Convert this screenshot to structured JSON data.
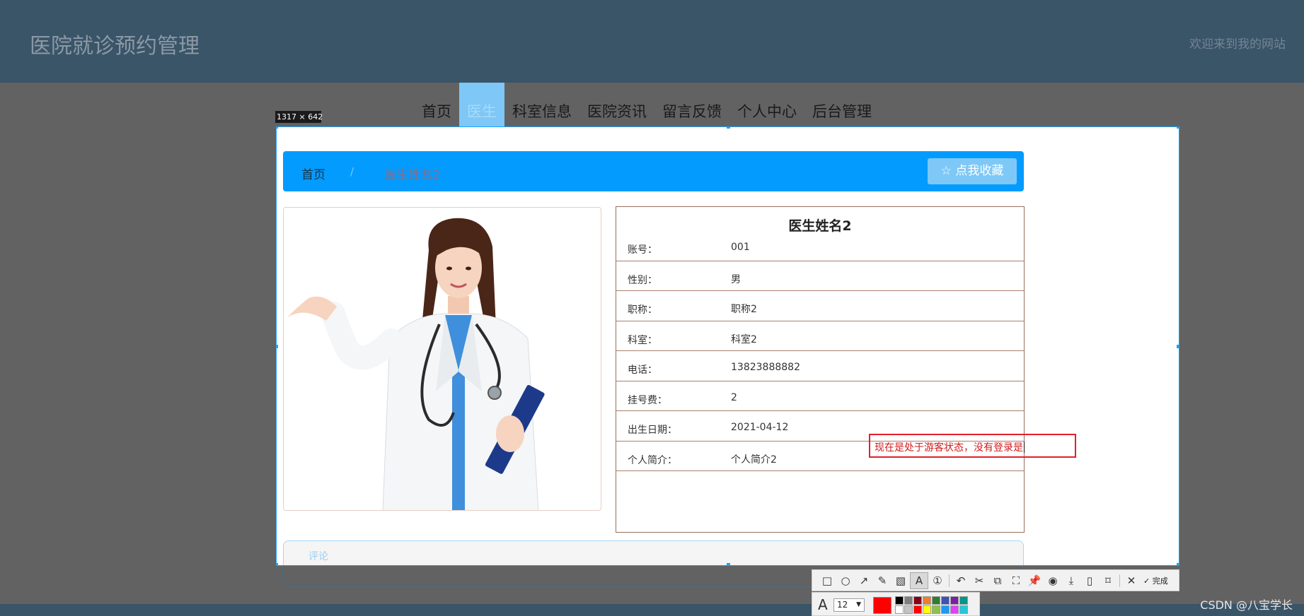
{
  "site": {
    "title": "医院就诊预约管理",
    "welcome": "欢迎来到我的网站"
  },
  "nav": {
    "items": [
      {
        "label": "首页",
        "active": false
      },
      {
        "label": "医生",
        "active": true
      },
      {
        "label": "科室信息",
        "active": false
      },
      {
        "label": "医院资讯",
        "active": false
      },
      {
        "label": "留言反馈",
        "active": false
      },
      {
        "label": "个人中心",
        "active": false
      },
      {
        "label": "后台管理",
        "active": false
      }
    ]
  },
  "capture": {
    "size_label": "1317 × 642"
  },
  "breadcrumb": {
    "home": "首页",
    "separator": "/",
    "current": "医生姓名2",
    "favorite_icon": "star-outline-icon",
    "favorite_label": "☆ 点我收藏"
  },
  "doctor": {
    "photo_alt": "doctor-photo",
    "name": "医生姓名2",
    "fields": [
      {
        "label": "账号：",
        "value": "001"
      },
      {
        "label": "性别：",
        "value": "男"
      },
      {
        "label": "职称：",
        "value": "职称2"
      },
      {
        "label": "科室：",
        "value": "科室2"
      },
      {
        "label": "电话：",
        "value": "13823888882"
      },
      {
        "label": "挂号费：",
        "value": "2"
      },
      {
        "label": "出生日期：",
        "value": "2021-04-12"
      },
      {
        "label": "个人简介：",
        "value": "个人简介2"
      }
    ]
  },
  "comments": {
    "label": "评论"
  },
  "annotation": {
    "text": "现在是处于游客状态，没有登录是",
    "color": "#e1202b"
  },
  "toolbar": {
    "tools": [
      {
        "name": "rectangle-tool",
        "glyph": "□"
      },
      {
        "name": "ellipse-tool",
        "glyph": "○"
      },
      {
        "name": "arrow-tool",
        "glyph": "↗"
      },
      {
        "name": "pen-tool",
        "glyph": "✎"
      },
      {
        "name": "mosaic-tool",
        "glyph": "▧"
      },
      {
        "name": "text-tool",
        "glyph": "A",
        "active": true
      },
      {
        "name": "number-tool",
        "glyph": "①"
      },
      {
        "name": "undo-tool",
        "glyph": "↶"
      },
      {
        "name": "cut-tool",
        "glyph": "✂"
      },
      {
        "name": "ocr-tool",
        "glyph": "⧉"
      },
      {
        "name": "long-screenshot-tool",
        "glyph": "⛶"
      },
      {
        "name": "pin-tool",
        "glyph": "📌"
      },
      {
        "name": "record-tool",
        "glyph": "◉"
      },
      {
        "name": "download-tool",
        "glyph": "⤓"
      },
      {
        "name": "phone-tool",
        "glyph": "▯"
      },
      {
        "name": "bookmark-tool",
        "glyph": "⌑"
      },
      {
        "name": "close-tool",
        "glyph": "✕"
      }
    ],
    "done_label": "✓ 完成",
    "font_size": "12",
    "current_color": "#ff0000",
    "palette": [
      "#000000",
      "#7f7f7f",
      "#880015",
      "#ed7d31",
      "#2e7d32",
      "#3f51b5",
      "#7b1fa2",
      "#009688",
      "#ffffff",
      "#c3c3c3",
      "#ff0000",
      "#ffff00",
      "#8bc34a",
      "#2196f3",
      "#e040fb",
      "#26c6da"
    ]
  },
  "watermark": "CSDN @八宝学长"
}
